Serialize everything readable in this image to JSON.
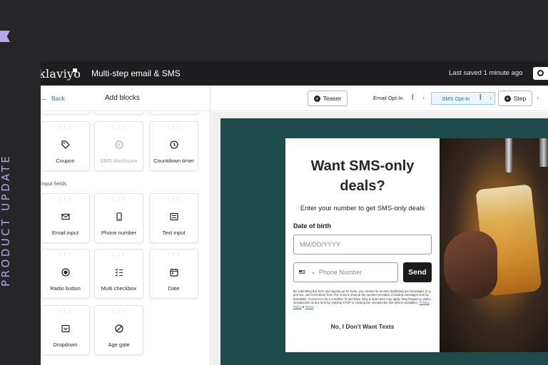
{
  "side": {
    "text": "PRODUCT UPDATE"
  },
  "topbar": {
    "logo": "klaviyo",
    "title": "Multi-step email & SMS",
    "saved": "Last saved 1 minute ago"
  },
  "left_panel": {
    "back_label": "Back",
    "title": "Add blocks",
    "section_input_fields": "Input fields",
    "blocks_row1": [
      {
        "label": "Coupon",
        "icon": "tag-icon",
        "disabled": false
      },
      {
        "label": "SMS disclosure",
        "icon": "message-icon",
        "disabled": true
      },
      {
        "label": "Countdown timer",
        "icon": "clock-icon",
        "disabled": false
      }
    ],
    "blocks_input": [
      {
        "label": "Email input",
        "icon": "envelope-icon"
      },
      {
        "label": "Phone number",
        "icon": "phone-icon"
      },
      {
        "label": "Text input",
        "icon": "text-box-icon"
      },
      {
        "label": "Radio button",
        "icon": "radio-icon"
      },
      {
        "label": "Multi checkbox",
        "icon": "checklist-icon"
      },
      {
        "label": "Date",
        "icon": "calendar-icon"
      },
      {
        "label": "Dropdown",
        "icon": "dropdown-icon"
      },
      {
        "label": "Age gate",
        "icon": "prohibited-icon"
      }
    ]
  },
  "tabs": {
    "teaser": "Teaser",
    "email_optin": "Email Opt-In",
    "sms_optin": "SMS Opt-In",
    "step": "Step"
  },
  "form": {
    "headline": "Want SMS-only deals?",
    "subtext": "Enter your number to get SMS-only deals",
    "dob_label": "Date of birth",
    "dob_placeholder": "MM/DD/YYYY",
    "phone_placeholder": "Phone Number",
    "send_label": "Send",
    "legal_text": "By submitting this form and signing up for texts, you consent to receive marketing text messages (e.g. promos, cart reminders) from The snooze shop at the number provided, including messages sent by autodialer. Consent is not a condition of purchase. Msg & data rates may apply. Msg frequency varies. Unsubscribe at any time by replying STOP or clicking the unsubscribe link (where available).",
    "privacy_link": "Privacy Policy",
    "amp": "&",
    "terms_link": "Terms",
    "decline": "No, I Don't Want Texts"
  },
  "colors": {
    "canvas_bg": "#1f4b4d",
    "accent_purple": "#b9a6e6",
    "topbar": "#1d1d1f"
  }
}
